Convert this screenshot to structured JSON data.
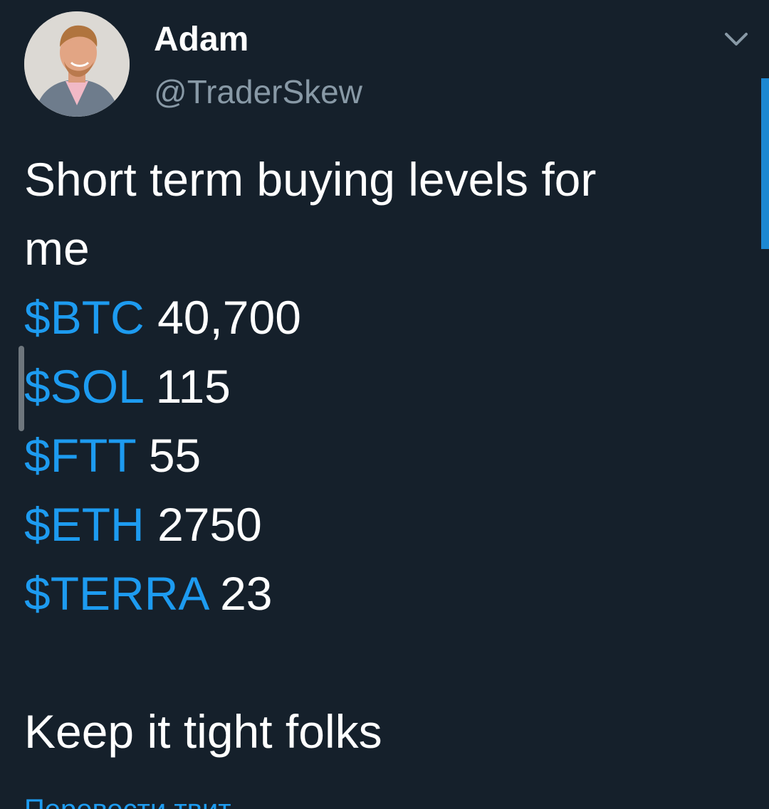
{
  "author": {
    "display_name": "Adam",
    "handle": "@TraderSkew"
  },
  "tweet": {
    "intro_line1": "Short term buying levels for",
    "intro_line2": "me",
    "levels": [
      {
        "cashtag": "$BTC",
        "value": "40,700"
      },
      {
        "cashtag": "$SOL",
        "value": "115"
      },
      {
        "cashtag": "$FTT",
        "value": "55"
      },
      {
        "cashtag": "$ETH",
        "value": "2750"
      },
      {
        "cashtag": "$TERRA",
        "value": "23"
      }
    ],
    "closing": "Keep it tight folks"
  },
  "translate_link": "Перевести твит",
  "colors": {
    "background": "#15202b",
    "text": "#ffffff",
    "secondary_text": "#8899a6",
    "link": "#1d9bf0"
  },
  "icons": {
    "menu": "chevron-down-icon"
  }
}
